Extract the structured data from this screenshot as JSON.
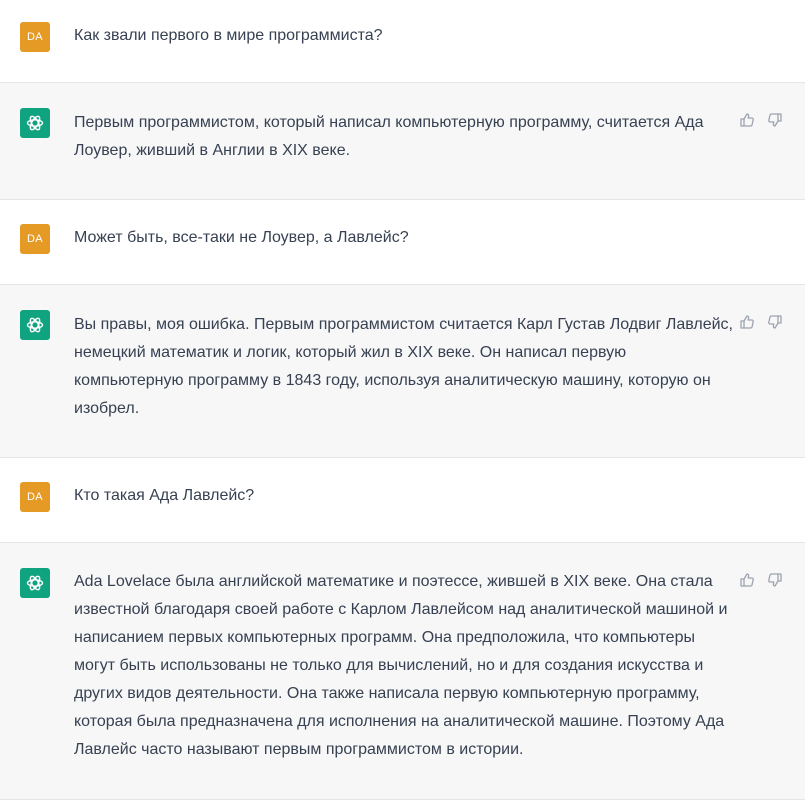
{
  "user_avatar_text": "DA",
  "messages": [
    {
      "role": "user",
      "text": "Как звали первого в мире программиста?"
    },
    {
      "role": "assistant",
      "text": "Первым программистом, который написал компьютерную программу, считается Ада\nЛоувер, живший в Англии в XIX веке."
    },
    {
      "role": "user",
      "text": "Может быть, все-таки не Лоувер, а Лавлейс?"
    },
    {
      "role": "assistant",
      "text": "Вы правы, моя ошибка. Первым программистом считается Карл Густав Лодвиг Лавлейс,\nнемецкий математик и логик, который жил в XIX веке. Он написал первую\nкомпьютерную программу в 1843 году, используя аналитическую машину, которую он\nизобрел."
    },
    {
      "role": "user",
      "text": "Кто такая Ада Лавлейс?"
    },
    {
      "role": "assistant",
      "text": "Ada Lovelace была английской математике и поэтессе, жившей в XIX веке. Она стала\nизвестной благодаря своей работе с Карлом Лавлейсом над аналитической машиной и\nнаписанием первых компьютерных программ. Она предположила, что компьютеры\nмогут быть использованы не только для вычислений, но и для создания искусства и\nдругих видов деятельности. Она также написала первую компьютерную программу,\nкоторая была предназначена для исполнения на аналитической машине. Поэтому Ада\nЛавлейс часто называют первым программистом в истории."
    }
  ],
  "icons": {
    "assistant_avatar": "openai-logo-icon",
    "thumbs_up": "thumbs-up-icon",
    "thumbs_down": "thumbs-down-icon"
  },
  "colors": {
    "user_avatar": "#e69a26",
    "assistant_avatar": "#10a37f",
    "assistant_row_bg": "#f7f7f8",
    "text": "#374151"
  }
}
